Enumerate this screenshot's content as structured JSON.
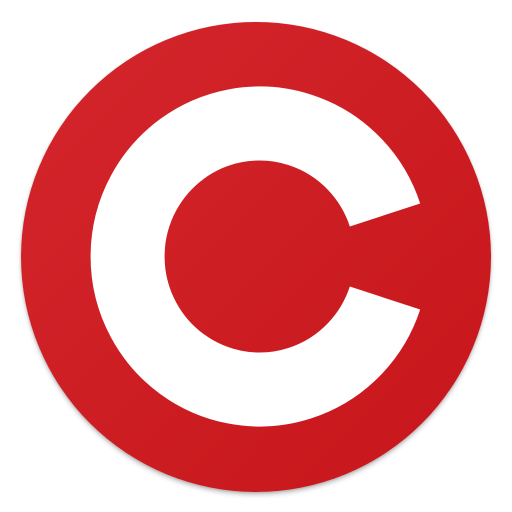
{
  "icon": {
    "name": "c-logo-icon",
    "letter": "C",
    "background_color": "#cd1e23",
    "letter_color": "#ffffff"
  }
}
